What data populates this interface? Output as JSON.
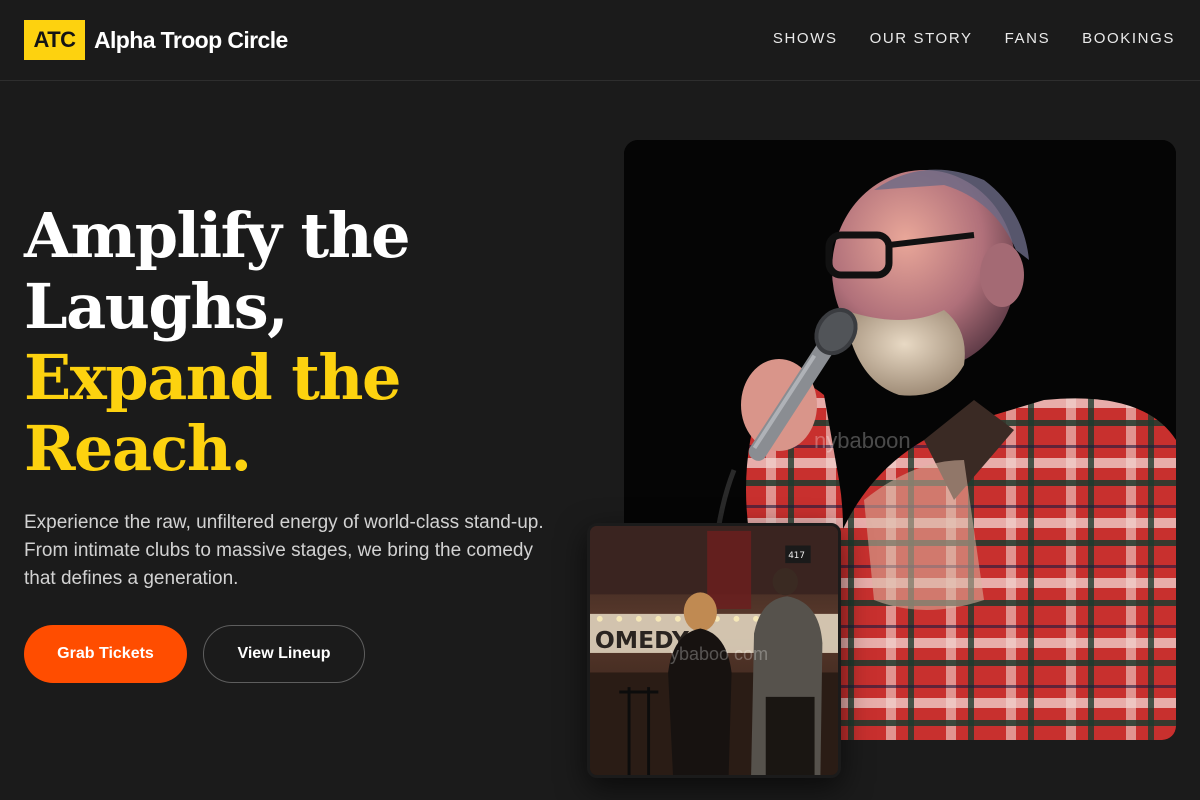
{
  "brand": {
    "badge": "ATC",
    "name": "Alpha Troop Circle",
    "accent": "#fdd20f"
  },
  "nav": {
    "items": [
      {
        "label": "SHOWS"
      },
      {
        "label": "OUR STORY"
      },
      {
        "label": "FANS"
      },
      {
        "label": "BOOKINGS"
      }
    ]
  },
  "hero": {
    "headline_white_1": "Amplify the",
    "headline_white_2": "Laughs,",
    "headline_yellow_1": "Expand the",
    "headline_yellow_2": "Reach.",
    "lede": "Experience the raw, unfiltered energy of world-class stand-up. From intimate clubs to massive stages, we bring the comedy that defines a generation.",
    "primary_cta": "Grab Tickets",
    "secondary_cta": "View Lineup",
    "primary_color": "#ff4d00"
  },
  "images": {
    "main_watermark": "nybaboon",
    "inset_watermark": "ybaboo com",
    "inset_sign_number": "417"
  }
}
